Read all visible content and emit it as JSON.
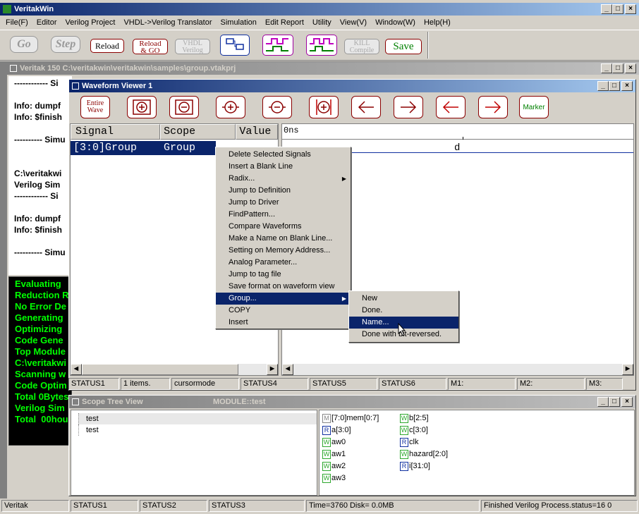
{
  "app": {
    "title": "VeritakWin",
    "menu": [
      "File(F)",
      "Editor",
      "Verilog Project",
      "VHDL->Verilog Translator",
      "Simulation",
      "Edit Report",
      "Utility",
      "View(V)",
      "Window(W)",
      "Help(H)"
    ],
    "toolbar": {
      "go": "Go",
      "step": "Step",
      "reload": "Reload",
      "reload_go_1": "Reload",
      "reload_go_2": "& GO",
      "vhdl_1": "VHDL",
      "vhdl_2": "Verilog",
      "kill_1": "KILL",
      "kill_2": "Compile",
      "save": "Save"
    }
  },
  "project_window": {
    "title": "Veritak 150 C:\\veritakwin\\veritakwin\\samples\\group.vtakprj",
    "console_lines": [
      "------------ Si",
      "",
      "Info: dumpf",
      "Info: $finish",
      "",
      "---------- Simu",
      "",
      "",
      "C:\\veritakwi",
      "Verilog Sim",
      "------------ Si",
      "",
      "Info: dumpf",
      "Info: $finish",
      "",
      "---------- Simu"
    ],
    "green_lines": [
      "Evaluating",
      "Reduction R",
      "No Error De",
      "Generating",
      "Optimizing",
      "Code Gene",
      "Top Module",
      "C:\\veritakwi",
      "Scanning w",
      "Code Optim",
      "Total 0Bytes",
      "Verilog Sim",
      "Total  00hou"
    ]
  },
  "waveform": {
    "title": "Waveform Viewer 1",
    "entire_wave_1": "Entire",
    "entire_wave_2": "Wave",
    "marker": "Marker",
    "col_signal": "Signal",
    "col_scope": "Scope",
    "col_value": "Value",
    "time_label": "0ns",
    "row_signal": "[3:0]Group",
    "row_scope": "Group",
    "row_value": "'   ' '   £",
    "wave_value": "d",
    "status": [
      "STATUS1",
      "1 items.",
      "cursormode",
      "STATUS4",
      "STATUS5",
      "STATUS6",
      "M1:",
      "M2:",
      "M3:"
    ]
  },
  "context_menu": {
    "items": [
      "Delete Selected Signals",
      "Insert a Blank Line",
      "Radix...",
      "Jump to Definition",
      "Jump to Driver",
      "FindPattern...",
      "Compare Waveforms",
      "Make a Name on Blank Line...",
      "Setting on Memory Address...",
      "Analog Parameter...",
      "Jump to tag file",
      "Save format on waveform view",
      "Group...",
      "COPY",
      "Insert"
    ],
    "submenu": [
      "New",
      "Done.",
      "Name...",
      "Done with bit-reversed."
    ]
  },
  "scope_tree": {
    "title": "Scope Tree View",
    "module": "MODULE::test",
    "tree": [
      "test",
      "test"
    ],
    "signals_col1": [
      {
        "t": "M",
        "n": "[7:0]mem[0:7]"
      },
      {
        "t": "R",
        "n": "a[3:0]"
      },
      {
        "t": "W",
        "n": "aw0"
      },
      {
        "t": "W",
        "n": "aw1"
      },
      {
        "t": "W",
        "n": "aw2"
      },
      {
        "t": "W",
        "n": "aw3"
      }
    ],
    "signals_col2": [
      {
        "t": "W",
        "n": "b[2:5]"
      },
      {
        "t": "W",
        "n": "c[3:0]"
      },
      {
        "t": "R",
        "n": "clk"
      },
      {
        "t": "W",
        "n": "hazard[2:0]"
      },
      {
        "t": "R",
        "n": "i[31:0]"
      }
    ]
  },
  "statusbar": [
    "Veritak",
    "STATUS1",
    "STATUS2",
    "STATUS3",
    "Time=3760 Disk=  0.0MB",
    "Finished Verilog Process.status=16 0"
  ],
  "colors": {
    "accent": "#0a246a",
    "tool_red": "#8b0000",
    "console_green": "#00ff00"
  }
}
